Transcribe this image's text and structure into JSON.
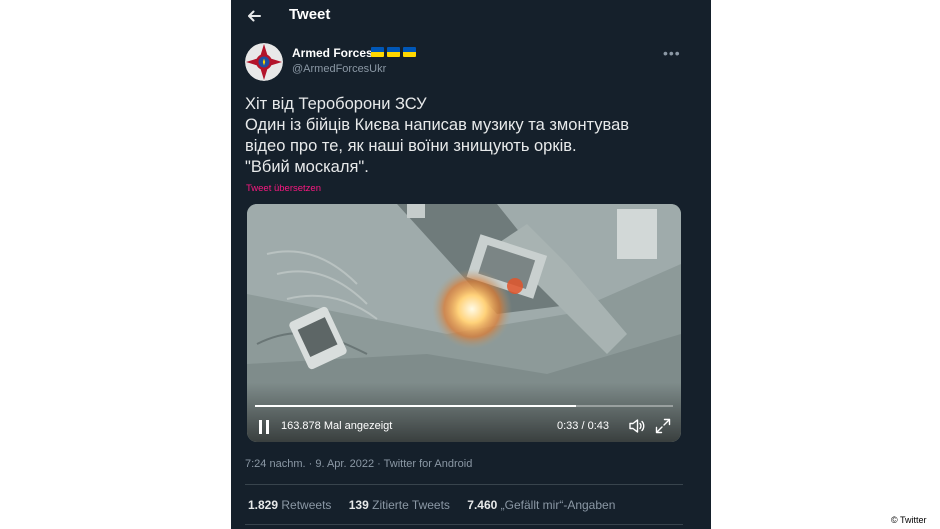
{
  "header": {
    "title": "Tweet",
    "back_icon": "arrow-left-icon"
  },
  "author": {
    "name": "Armed Forces",
    "handle": "@ArmedForcesUkr",
    "flag_emojis": 3,
    "avatar_colors": {
      "outer": "#e8e8e8",
      "ring": "#b3132a",
      "emblem": "#1f4fa0"
    }
  },
  "tweet": {
    "lines": [
      "Хіт від Тероборони ЗСУ",
      "Один із бійців Києва написав музику та змонтував",
      "відео про те, як наші воїни знищують орків.",
      "\"Вбий москаля\"."
    ],
    "translate_label": "Tweet übersetzen"
  },
  "video": {
    "view_count": "163.878 Mal angezeigt",
    "time": "0:33 / 0:43",
    "progress": 0.767
  },
  "meta": {
    "time": "7:24 nachm.",
    "date": "9. Apr. 2022",
    "source": "Twitter for Android",
    "separator": "·"
  },
  "stats": {
    "retweets_count": "1.829",
    "retweets_label": "Retweets",
    "quotes_count": "139",
    "quotes_label": "Zitierte Tweets",
    "likes_count": "7.460",
    "likes_label": "„Gefällt mir“-Angaben"
  },
  "credit": "© Twitter",
  "colors": {
    "background": "#15202b",
    "text": "#e7e9ea",
    "secondary": "#8b98a5",
    "accent": "#f91880",
    "flag_blue": "#0057b7",
    "flag_yellow": "#ffd700"
  }
}
